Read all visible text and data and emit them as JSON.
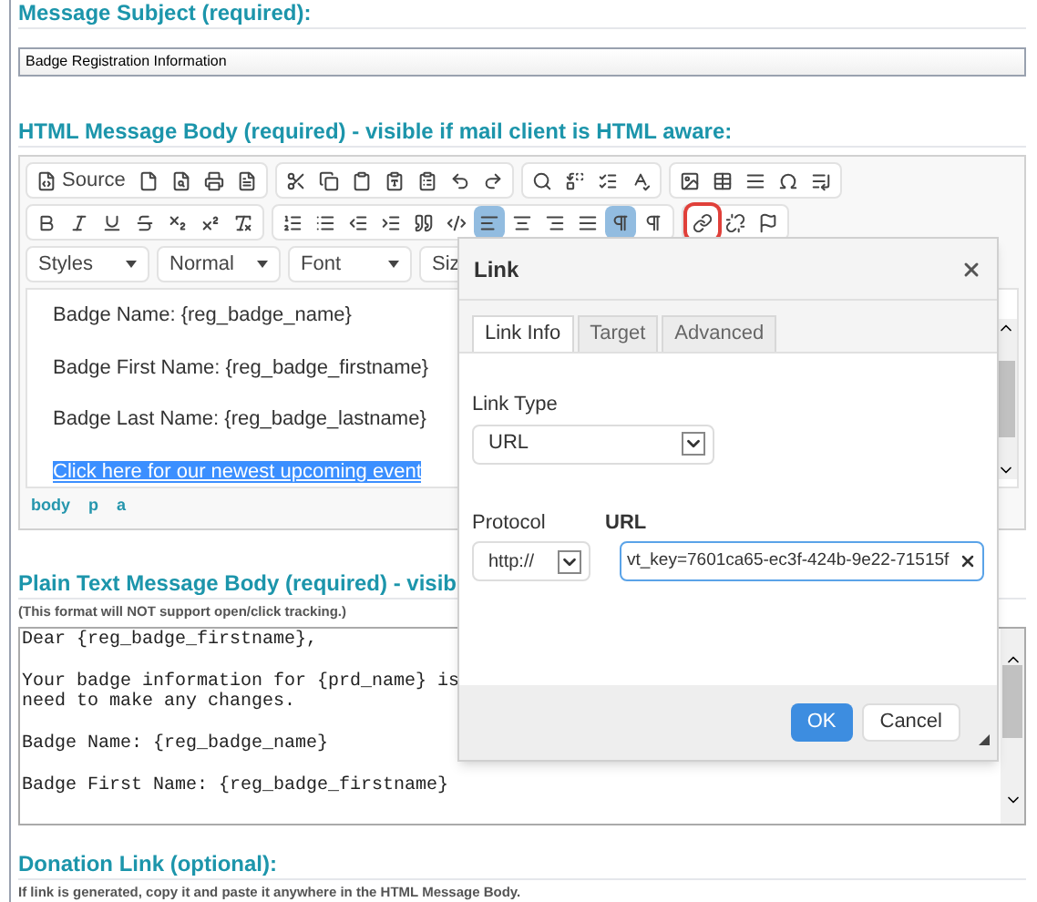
{
  "subject": {
    "heading": "Message Subject (required):",
    "value": "Badge Registration Information"
  },
  "html_body": {
    "heading": "HTML Message Body (required) - visible if mail client is HTML aware:",
    "toolbar": [
      [
        [
          {
            "label": "Source",
            "selected": false,
            "outlined": false
          },
          {
            "selected": false,
            "outlined": false
          },
          {
            "selected": false,
            "outlined": false
          },
          {
            "selected": false,
            "outlined": false
          },
          {
            "selected": false,
            "outlined": false
          }
        ],
        [
          {
            "selected": false,
            "outlined": false
          },
          {
            "selected": false,
            "outlined": false
          },
          {
            "selected": false,
            "outlined": false
          },
          {
            "selected": false,
            "outlined": false
          },
          {
            "selected": false,
            "outlined": false
          },
          {
            "selected": false,
            "outlined": false
          },
          {
            "selected": false,
            "outlined": false
          }
        ],
        [
          {
            "selected": false,
            "outlined": false
          },
          {
            "selected": false,
            "outlined": false
          },
          {
            "selected": false,
            "outlined": false
          },
          {
            "selected": false,
            "outlined": false
          }
        ],
        [
          {
            "selected": false,
            "outlined": false
          },
          {
            "selected": false,
            "outlined": false
          },
          {
            "selected": false,
            "outlined": false
          },
          {
            "selected": false,
            "outlined": false
          },
          {
            "selected": false,
            "outlined": false
          }
        ]
      ],
      [
        [
          {
            "selected": false,
            "outlined": false
          },
          {
            "selected": false,
            "outlined": false
          },
          {
            "selected": false,
            "outlined": false
          },
          {
            "selected": false,
            "outlined": false
          },
          {
            "selected": false,
            "outlined": false
          },
          {
            "selected": false,
            "outlined": false
          },
          {
            "selected": false,
            "outlined": false
          }
        ],
        [
          {
            "selected": false,
            "outlined": false
          },
          {
            "selected": false,
            "outlined": false
          },
          {
            "selected": false,
            "outlined": false
          },
          {
            "selected": false,
            "outlined": false
          },
          {
            "selected": false,
            "outlined": false
          },
          {
            "selected": false,
            "outlined": false
          },
          {
            "selected": true,
            "outlined": false
          },
          {
            "selected": false,
            "outlined": false
          },
          {
            "selected": false,
            "outlined": false
          },
          {
            "selected": false,
            "outlined": false
          },
          {
            "selected": true,
            "outlined": false
          },
          {
            "selected": false,
            "outlined": false
          }
        ],
        [
          {
            "selected": false,
            "outlined": true
          },
          {
            "selected": false,
            "outlined": false
          },
          {
            "selected": false,
            "outlined": false
          }
        ]
      ]
    ],
    "combos": [
      {
        "label": "Styles"
      },
      {
        "label": "Normal"
      },
      {
        "label": "Font"
      },
      {
        "label": "Siz"
      }
    ],
    "paragraphs": [
      "Badge Name: {reg_badge_name}",
      "Badge First Name: {reg_badge_firstname}",
      "Badge Last Name: {reg_badge_lastname}"
    ],
    "link": {
      "text": "Click here for our newest upcoming event",
      "selected": true
    },
    "path": [
      "body",
      "p",
      "a"
    ]
  },
  "plain_body": {
    "heading": "Plain Text Message Body (required) - visib",
    "note": "(This format will NOT support open/click tracking.)",
    "paragraphs": [
      [
        "Dear {reg_badge_firstname},"
      ],
      [
        "Your badge information for {prd_name} is",
        "need to make any changes."
      ],
      [
        "Badge Name: {reg_badge_name}"
      ],
      [
        "Badge First Name: {reg_badge_firstname}"
      ]
    ]
  },
  "donation": {
    "heading": "Donation Link (optional):",
    "note": "If link is generated, copy it and paste it anywhere in the HTML Message Body."
  },
  "dialog": {
    "title": "Link",
    "tabs": [
      {
        "label": "Link Info",
        "selected": true
      },
      {
        "label": "Target",
        "selected": false
      },
      {
        "label": "Advanced",
        "selected": false
      }
    ],
    "link_type": {
      "label": "Link Type",
      "value": "URL"
    },
    "protocol": {
      "label": "Protocol",
      "value": "http://"
    },
    "url": {
      "label": "URL",
      "value": "vt_key=7601ca65-ec3f-424b-9e22-71515f"
    },
    "buttons": [
      {
        "label": "OK",
        "kind": "primary"
      },
      {
        "label": "Cancel",
        "kind": "secondary"
      }
    ]
  }
}
